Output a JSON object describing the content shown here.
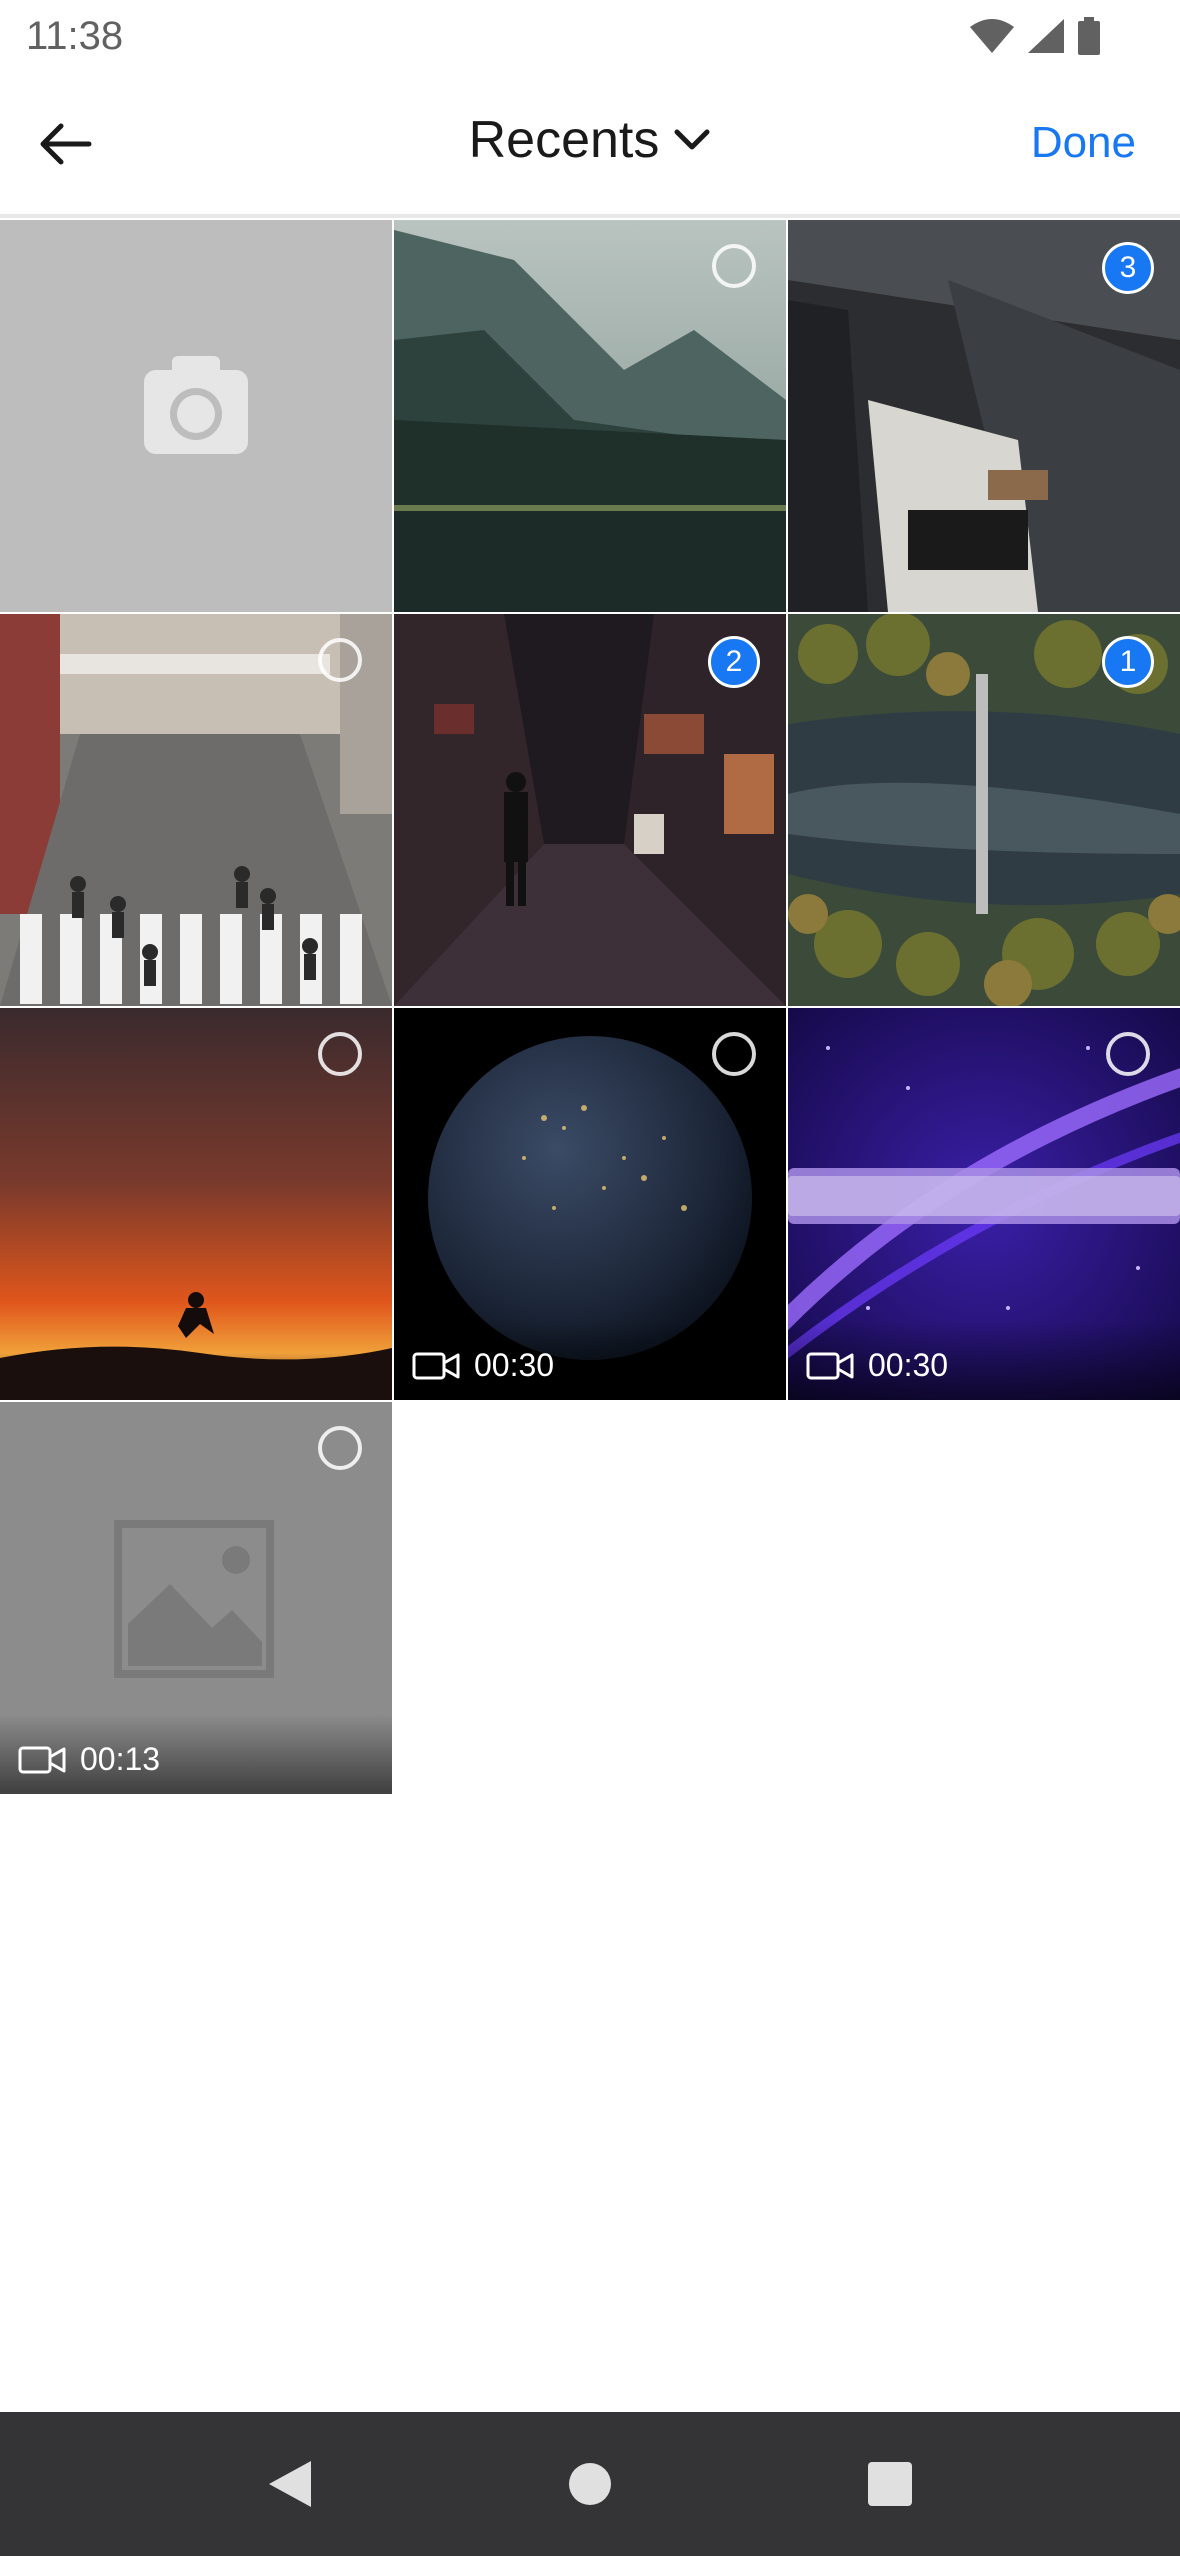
{
  "status_bar": {
    "time": "11:38",
    "icons": [
      "wifi-icon",
      "signal-icon",
      "battery-icon"
    ]
  },
  "header": {
    "back_icon": "arrow-left-icon",
    "title": "Recents",
    "title_icon": "chevron-down-icon",
    "done_label": "Done"
  },
  "grid": {
    "tiles": [
      {
        "kind": "camera",
        "icon": "camera-icon"
      },
      {
        "kind": "photo",
        "subject": "misty mountain forest lake",
        "selected": false
      },
      {
        "kind": "photo",
        "subject": "bus at train station",
        "selected": true,
        "selection_number": "3"
      },
      {
        "kind": "photo",
        "subject": "street crosswalk with pedestrians",
        "selected": false
      },
      {
        "kind": "photo",
        "subject": "night alley street",
        "selected": true,
        "selection_number": "2"
      },
      {
        "kind": "photo",
        "subject": "aerial forest river",
        "selected": true,
        "selection_number": "1"
      },
      {
        "kind": "photo",
        "subject": "sunset silhouette jump",
        "selected": false
      },
      {
        "kind": "video",
        "subject": "earth at night",
        "duration": "00:30",
        "selected": false
      },
      {
        "kind": "video",
        "subject": "purple motion graphics",
        "duration": "00:30",
        "selected": false
      },
      {
        "kind": "video",
        "subject": "image placeholder",
        "duration": "00:13",
        "selected": false
      }
    ]
  },
  "colors": {
    "accent": "#1877f2",
    "nav_bar": "#343437",
    "header_text": "#1a1a1a"
  },
  "nav_bar": {
    "buttons": [
      "nav-back-icon",
      "nav-home-icon",
      "nav-recents-icon"
    ]
  }
}
